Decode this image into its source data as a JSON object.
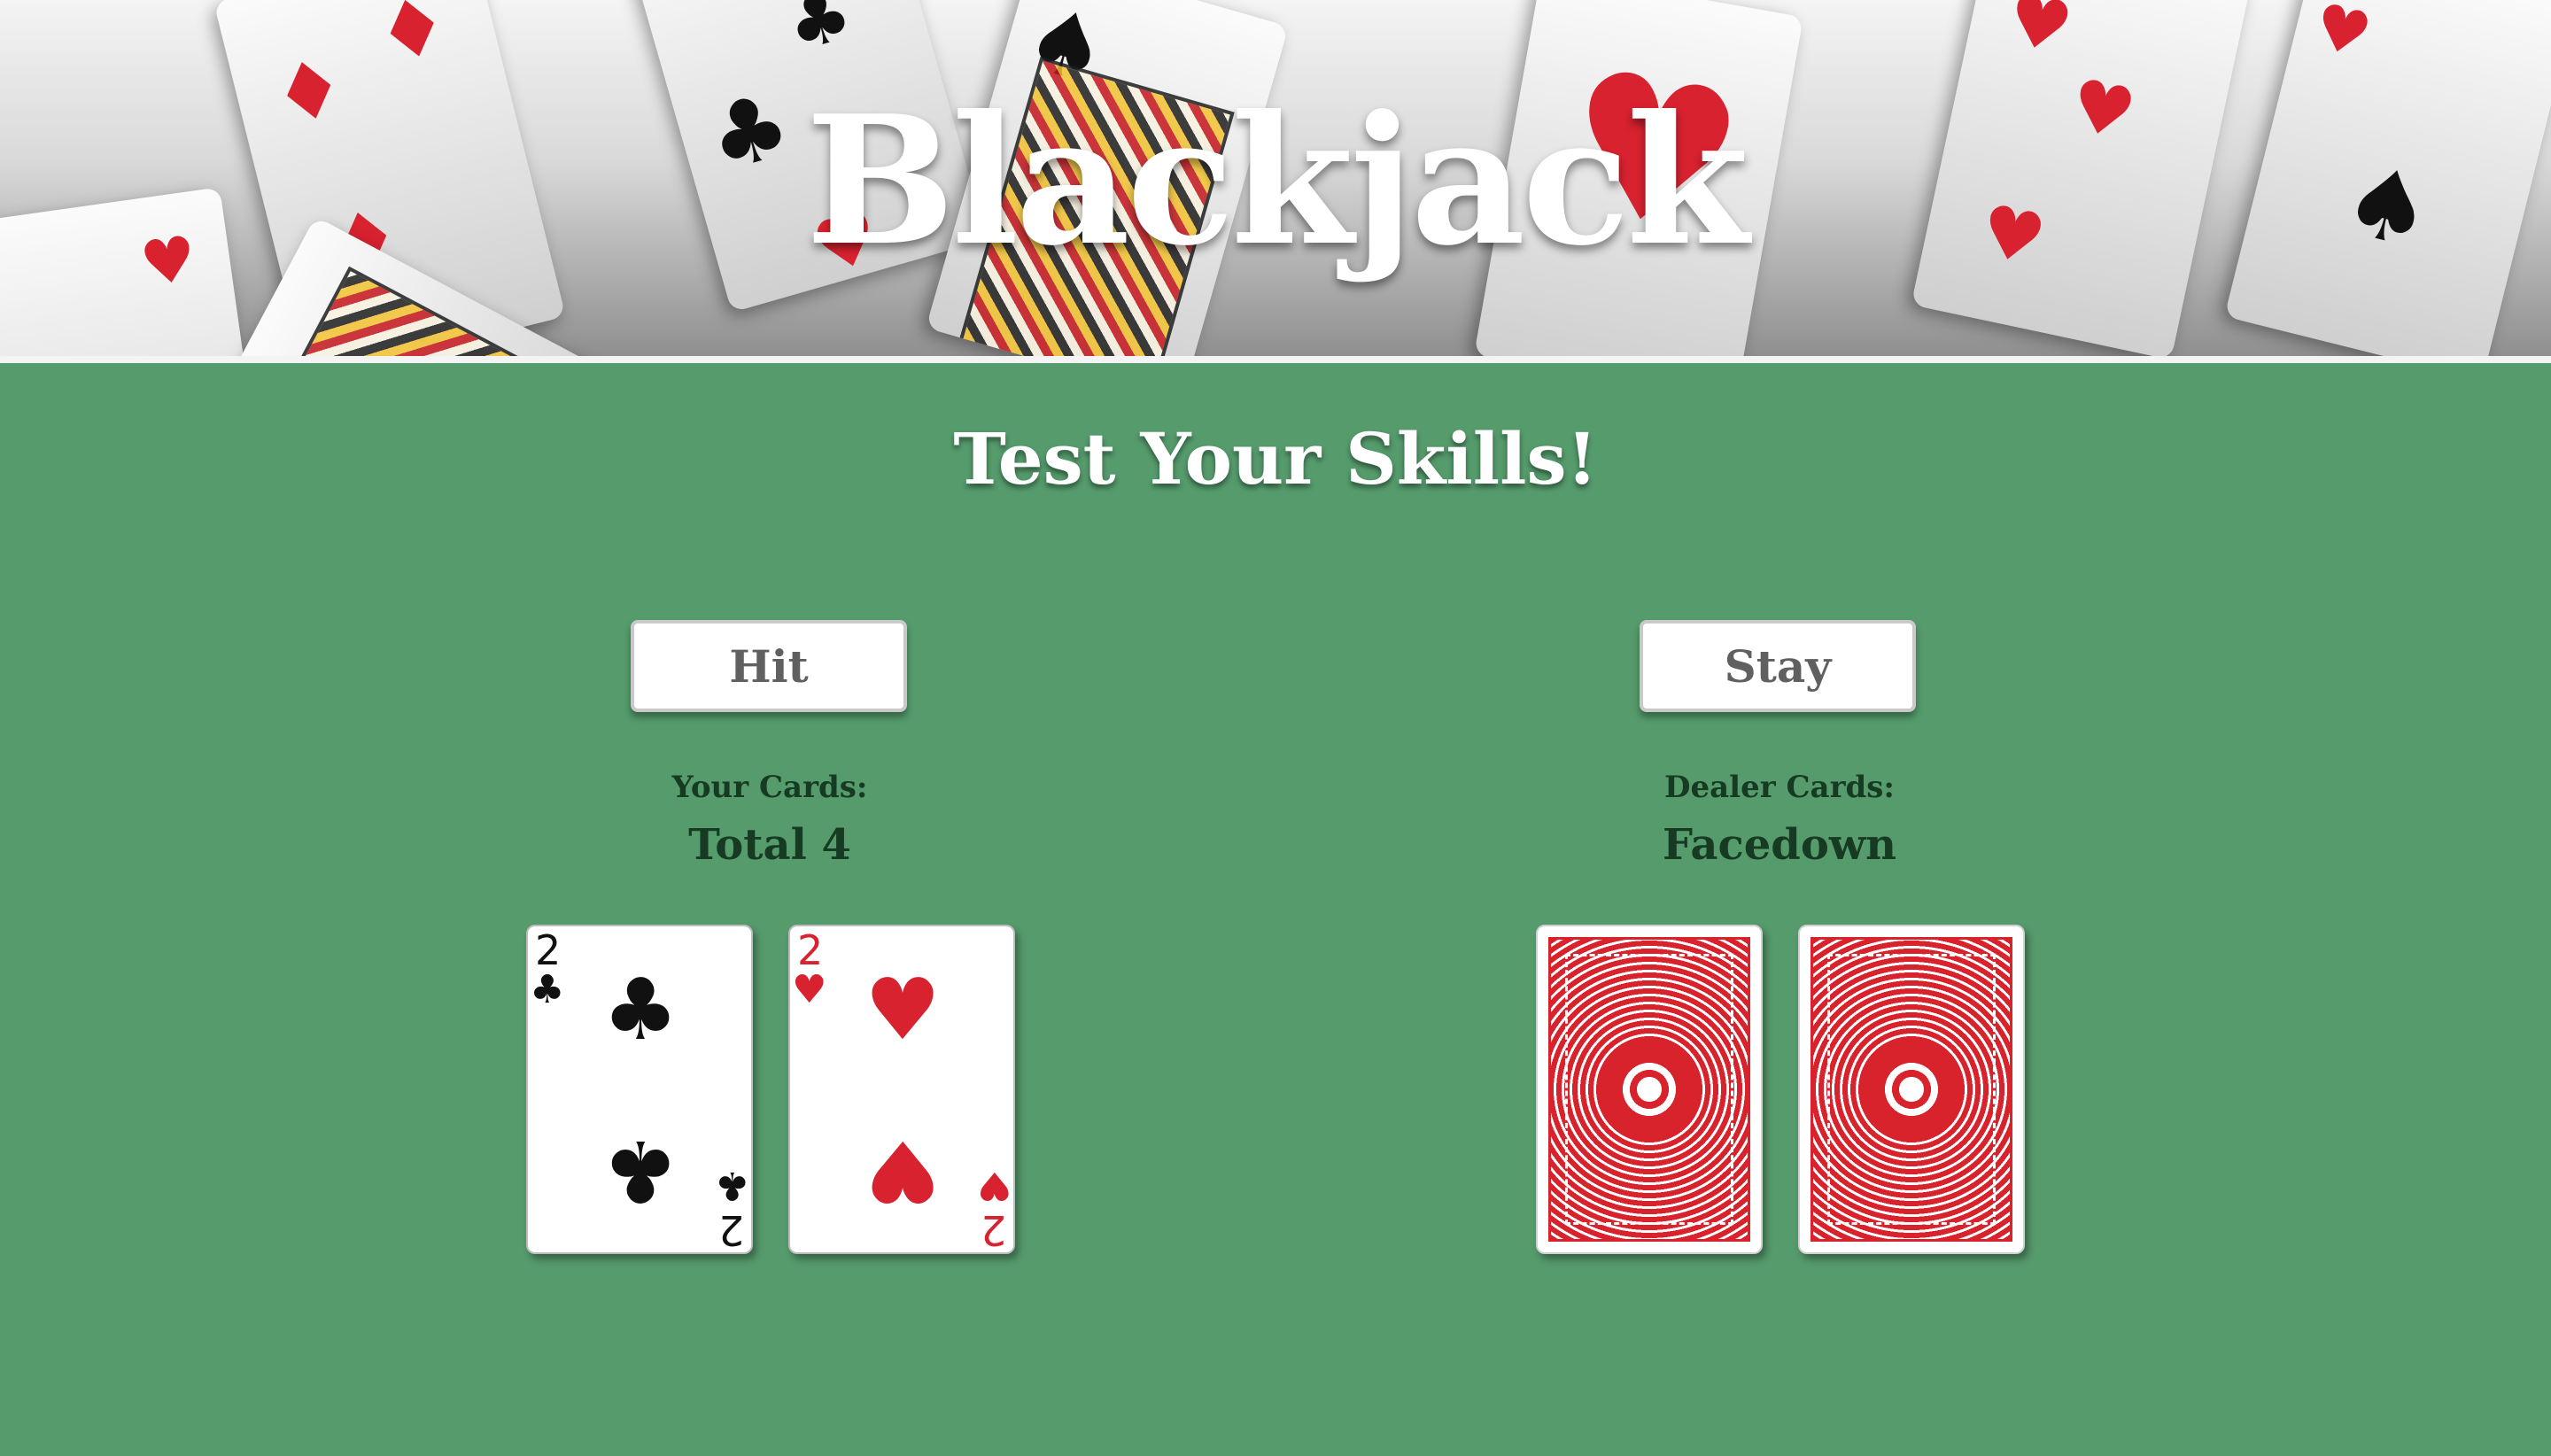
{
  "header": {
    "title": "Blackjack"
  },
  "main": {
    "subtitle": "Test Your Skills!",
    "hit_label": "Hit",
    "stay_label": "Stay"
  },
  "player": {
    "cards_label": "Your Cards:",
    "total_label": "Total 4",
    "cards": [
      {
        "rank": "2",
        "suit": "♣",
        "color": "#111111"
      },
      {
        "rank": "2",
        "suit": "♥",
        "color": "#d8222f"
      }
    ]
  },
  "dealer": {
    "cards_label": "Dealer Cards:",
    "total_label": "Facedown",
    "card_back_color": "#d8232c"
  },
  "colors": {
    "table_green": "#559b6c",
    "label_dark_green": "#173a22"
  }
}
